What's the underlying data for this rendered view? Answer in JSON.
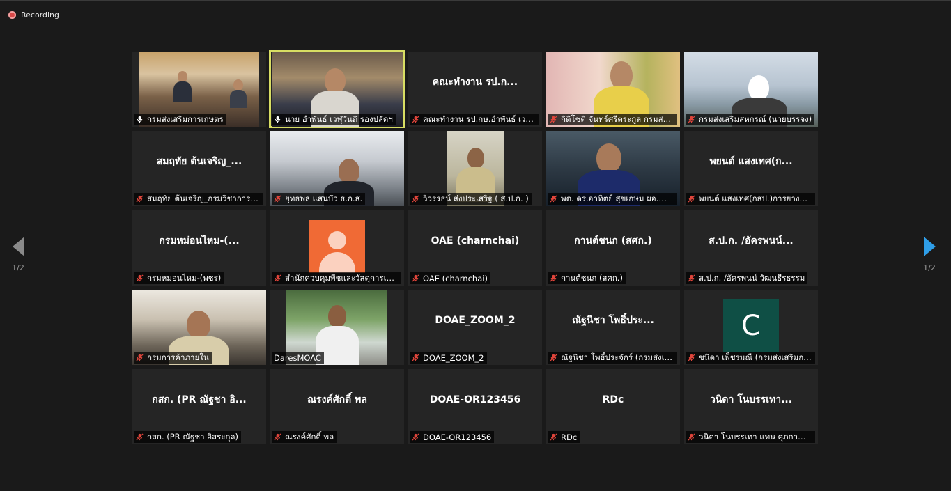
{
  "recording": {
    "label": "Recording"
  },
  "nav": {
    "prev_page": "1/2",
    "next_page": "1/2"
  },
  "colors": {
    "active_speaker_border": "#d8de63",
    "next_arrow": "#2f9ee8",
    "mic_muted": "#e0453b",
    "orange_avatar": "#f06a35",
    "green_avatar": "#0f4f45"
  },
  "tiles": [
    {
      "name": "กรมส่งเสริมการเกษตร",
      "display": "",
      "kind": "video",
      "mic": "on"
    },
    {
      "name": "นาย อำพันธ์ เวฬุวันติ รองปลัดฯ",
      "display": "",
      "kind": "video",
      "mic": "on",
      "active": true
    },
    {
      "name": "คณะทำงาน รป.กษ.อำพันธ์ เวฬุวันติ",
      "display": "คณะทำงาน รป.ก...",
      "kind": "name",
      "mic": "muted"
    },
    {
      "name": "กิติโชติ จันทร์ศรีตระกูล กรมส่งเสริมการเกษตร",
      "display": "",
      "kind": "video",
      "mic": "muted"
    },
    {
      "name": "กรมส่งเสริมสหกรณ์ (นายบรรจง)",
      "display": "",
      "kind": "video",
      "mic": "muted"
    },
    {
      "name": "สมฤทัย ต้นเจริญ_กรมวิชาการเกษตร",
      "display": "สมฤทัย ต้นเจริญ_...",
      "kind": "name",
      "mic": "muted"
    },
    {
      "name": "ยุทธพล แสนบัว ธ.ก.ส.",
      "display": "",
      "kind": "video",
      "mic": "muted"
    },
    {
      "name": "วิวรรธน์ ส่งประเสริฐ ( ส.ป.ก. )",
      "display": "",
      "kind": "video",
      "mic": "muted"
    },
    {
      "name": "พต. ดร.อาทิตย์ สุขเกษม ผอ.สำนัก",
      "display": "",
      "kind": "video",
      "mic": "muted"
    },
    {
      "name": "พยนต์ แสงเทศ(กสป.)การยางแห่งประเทศไทย",
      "display": "พยนต์ แสงเทศ(ก...",
      "kind": "name",
      "mic": "muted"
    },
    {
      "name": "กรมหม่อนไหม-(พชร)",
      "display": "กรมหม่อนไหม-(...",
      "kind": "name",
      "mic": "muted"
    },
    {
      "name": "สำนักควบคุมพืชและวัสดุการเกษตร",
      "display": "",
      "kind": "avatar-orange",
      "mic": "muted"
    },
    {
      "name": "OAE (charnchai)",
      "display": "OAE (charnchai)",
      "kind": "name",
      "mic": "muted"
    },
    {
      "name": "กานต์ชนก (สศก.)",
      "display": "กานต์ชนก (สศก.)",
      "kind": "name",
      "mic": "muted"
    },
    {
      "name": "ส.ป.ก. /อัครพนน์ วัฒนธีรธรรม",
      "display": "ส.ป.ก. /อัครพนน์...",
      "kind": "name",
      "mic": "muted"
    },
    {
      "name": "กรมการค้าภายใน",
      "display": "",
      "kind": "video",
      "mic": "muted"
    },
    {
      "name": "DaresMOAC",
      "display": "",
      "kind": "video",
      "mic": "none"
    },
    {
      "name": "DOAE_ZOOM_2",
      "display": "DOAE_ZOOM_2",
      "kind": "name",
      "mic": "muted"
    },
    {
      "name": "ณัฐนิชา โพธิ์ประจักร์ (กรมส่งเสริมการเกษตร)",
      "display": "ณัฐนิชา โพธิ์ประ...",
      "kind": "name",
      "mic": "muted"
    },
    {
      "name": "ชนิดา เพ็ชรมณี (กรมส่งเสริมการเกษตร)",
      "display": "",
      "kind": "avatar-green",
      "avatar_letter": "C",
      "mic": "muted"
    },
    {
      "name": "กสก. (PR ณัฐชา อิสระกุล)",
      "display": "กสก. (PR ณัฐชา อิ...",
      "kind": "name",
      "mic": "muted"
    },
    {
      "name": "ณรงค์ศักดิ์ พล",
      "display": "ณรงค์ศักดิ์ พล",
      "kind": "name",
      "mic": "muted"
    },
    {
      "name": "DOAE-OR123456",
      "display": "DOAE-OR123456",
      "kind": "name",
      "mic": "muted"
    },
    {
      "name": "RDc",
      "display": "RDc",
      "kind": "name",
      "mic": "muted"
    },
    {
      "name": "วนิดา โนบรรเทา แทน ศุภกาญจน์",
      "display": "วนิดา โนบรรเทา...",
      "kind": "name",
      "mic": "muted"
    }
  ]
}
